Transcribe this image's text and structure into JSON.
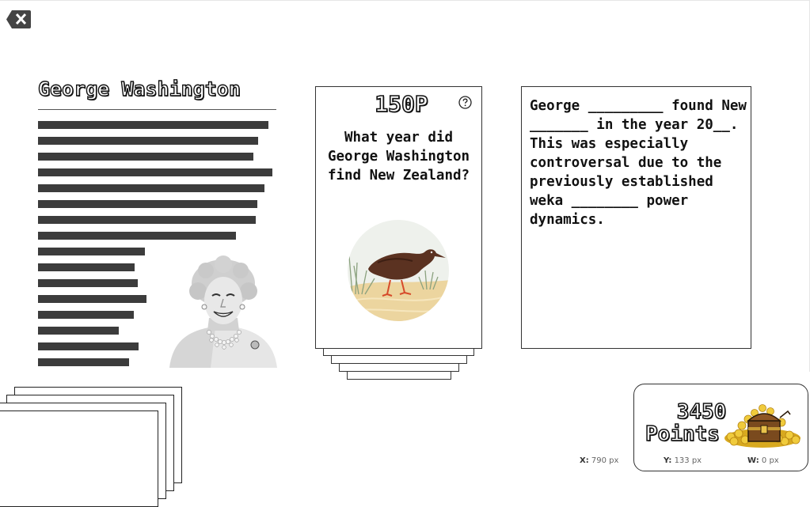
{
  "toolbar": {
    "back_icon": "back-close-icon"
  },
  "article": {
    "title": "George Washington",
    "line_widths_pct": [
      291,
      278,
      272,
      296,
      286,
      277,
      275,
      250,
      135,
      122,
      126,
      137,
      121,
      102,
      127,
      115
    ],
    "portrait_icon": "portrait-photo"
  },
  "question_card": {
    "points": "150P",
    "help_icon": "question-circle-icon",
    "question": "What year did George Washington find New Zealand?",
    "image_icon": "weka-bird-illustration"
  },
  "fill_card": {
    "text": "George _________ found New _______ in the year 20__. This was especially controversal due to the previously established weka ________ power dynamics."
  },
  "score": {
    "value": "3450",
    "label": "Points",
    "icon": "treasure-chest-icon"
  },
  "status": {
    "x_label": "X:",
    "x_value": "790 px",
    "y_label": "Y:",
    "y_value": "133 px",
    "w_label": "W:",
    "w_value": "0 px"
  },
  "colors": {
    "text_bar": "#3c3c3c",
    "border": "#333333",
    "gold": "#e3b92b"
  }
}
